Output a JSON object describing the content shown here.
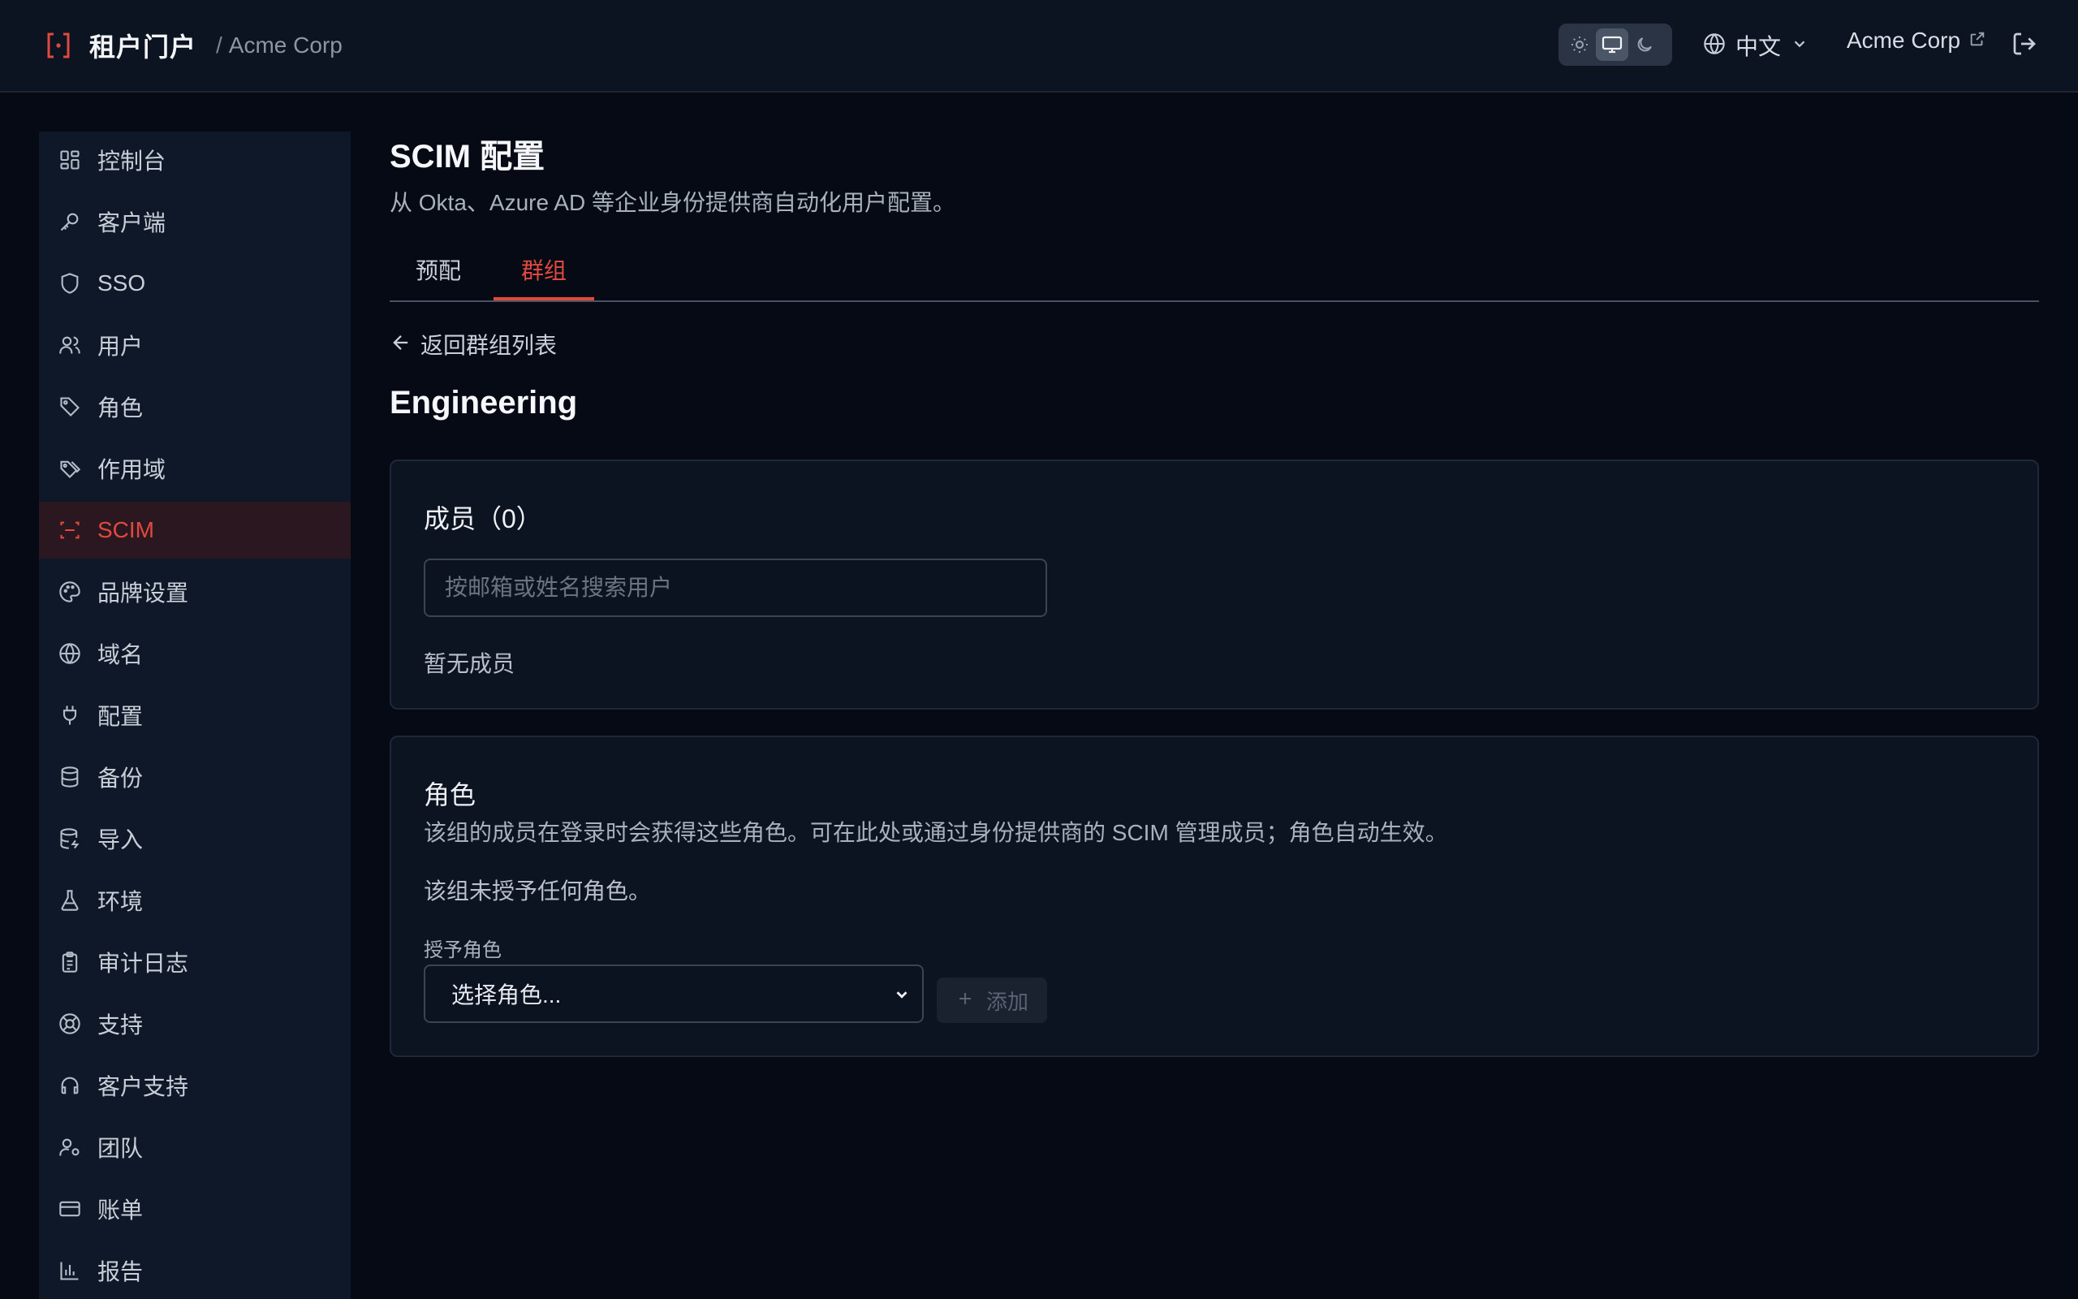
{
  "header": {
    "app_title": "租户门户",
    "separator": "/",
    "org_name": "Acme Corp",
    "theme_options": [
      "sun-icon",
      "monitor-icon",
      "moon-icon"
    ],
    "theme_selected": "monitor-icon",
    "language": "中文",
    "org_link": "Acme Corp"
  },
  "sidebar": {
    "items": [
      {
        "label": "控制台",
        "icon": "dashboard-icon"
      },
      {
        "label": "客户端",
        "icon": "key-icon"
      },
      {
        "label": "SSO",
        "icon": "shield-icon"
      },
      {
        "label": "用户",
        "icon": "users-icon"
      },
      {
        "label": "角色",
        "icon": "tag-icon"
      },
      {
        "label": "作用域",
        "icon": "tags-icon"
      },
      {
        "label": "SCIM",
        "icon": "scan-icon",
        "active": true
      },
      {
        "label": "品牌设置",
        "icon": "palette-icon"
      },
      {
        "label": "域名",
        "icon": "globe-icon"
      },
      {
        "label": "配置",
        "icon": "plug-icon"
      },
      {
        "label": "备份",
        "icon": "database-icon"
      },
      {
        "label": "导入",
        "icon": "database-import-icon"
      },
      {
        "label": "环境",
        "icon": "flask-icon"
      },
      {
        "label": "审计日志",
        "icon": "clipboard-icon"
      },
      {
        "label": "支持",
        "icon": "lifebuoy-icon"
      },
      {
        "label": "客户支持",
        "icon": "headset-icon"
      },
      {
        "label": "团队",
        "icon": "user-cog-icon"
      },
      {
        "label": "账单",
        "icon": "credit-card-icon"
      },
      {
        "label": "报告",
        "icon": "bar-chart-icon"
      }
    ]
  },
  "page": {
    "title": "SCIM 配置",
    "subtitle": "从 Okta、Azure AD 等企业身份提供商自动化用户配置。",
    "tabs": [
      {
        "label": "预配",
        "active": false
      },
      {
        "label": "群组",
        "active": true
      }
    ],
    "back_label": "返回群组列表",
    "group_name": "Engineering"
  },
  "members_card": {
    "title": "成员（0）",
    "search_placeholder": "按邮箱或姓名搜索用户",
    "empty_text": "暂无成员"
  },
  "roles_card": {
    "title": "角色",
    "description": "该组的成员在登录时会获得这些角色。可在此处或通过身份提供商的 SCIM 管理成员；角色自动生效。",
    "no_roles_text": "该组未授予任何角色。",
    "grant_label": "授予角色",
    "select_value": "选择角色...",
    "add_label": "添加"
  },
  "colors": {
    "accent": "#e0493f",
    "background": "#050a14",
    "panel": "#0f1828"
  }
}
